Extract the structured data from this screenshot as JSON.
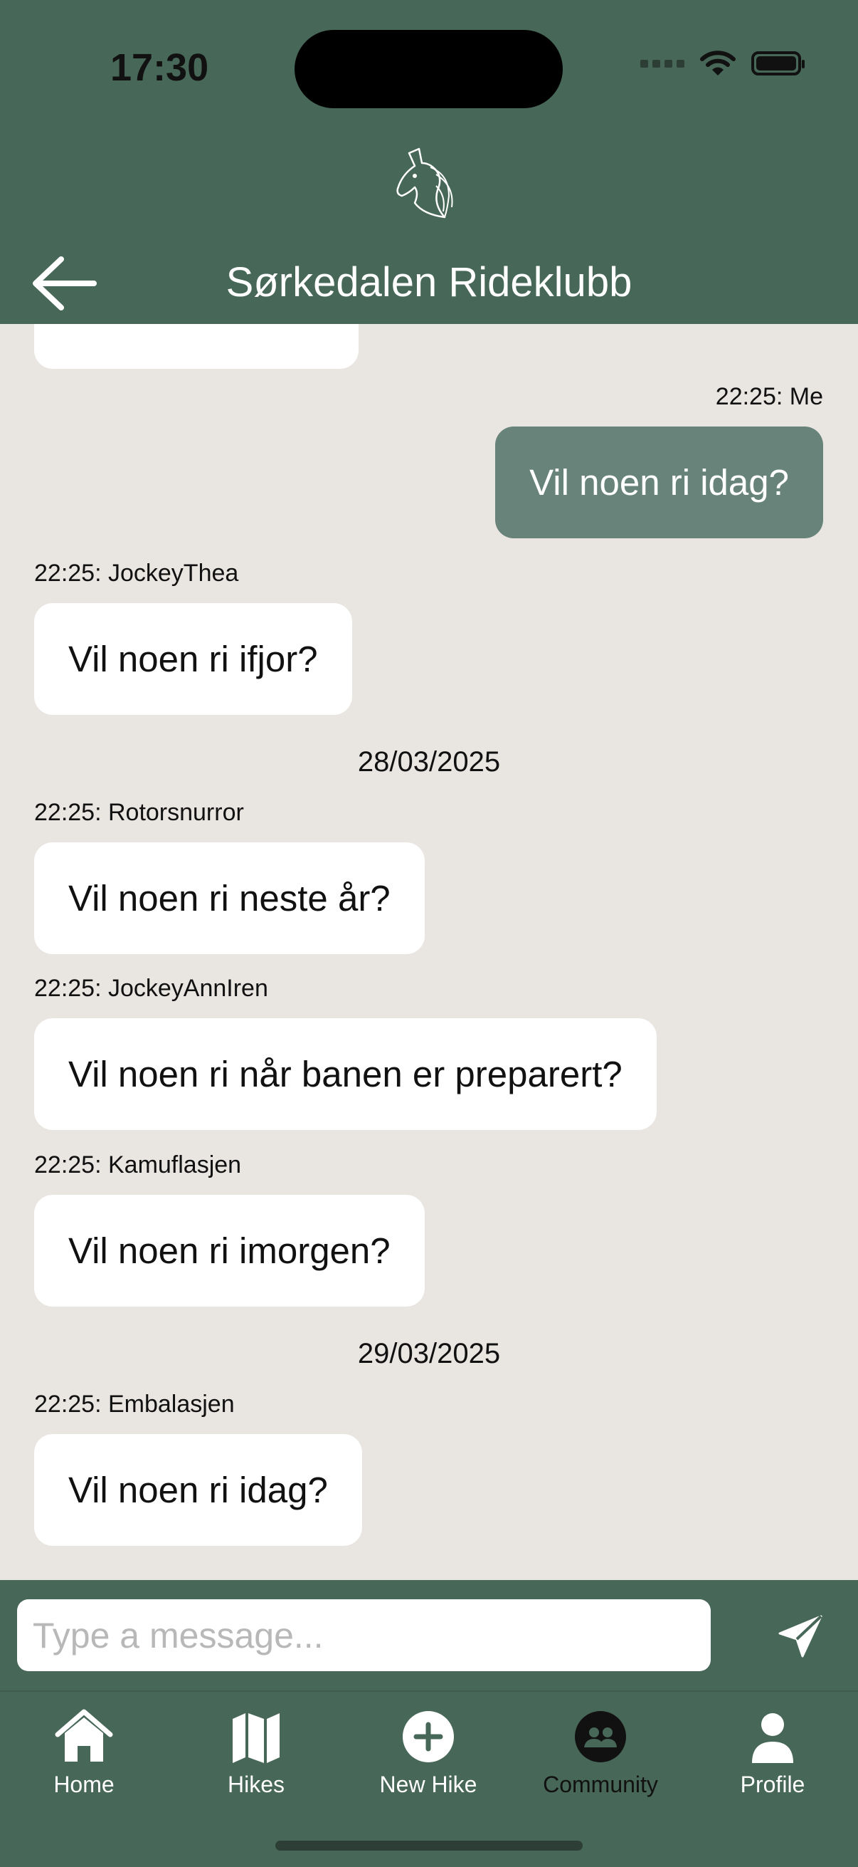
{
  "status_bar": {
    "time": "17:30"
  },
  "header": {
    "title": "Sørkedalen Rideklubb"
  },
  "messages": [
    {
      "meta": "22:25: Me",
      "text": "Vil noen ri idag?"
    },
    {
      "meta": "22:25: JockeyThea",
      "text": "Vil noen ri ifjor?"
    },
    {
      "meta": "22:25: Rotorsnurror",
      "text": "Vil noen ri neste år?"
    },
    {
      "meta": "22:25: JockeyAnnIren",
      "text": "Vil noen ri når banen er preparert?"
    },
    {
      "meta": "22:25: Kamuflasjen",
      "text": "Vil noen ri imorgen?"
    },
    {
      "meta": "22:25: Embalasjen",
      "text": "Vil noen ri idag?"
    }
  ],
  "dates": [
    "28/03/2025",
    "29/03/2025"
  ],
  "composer": {
    "placeholder": "Type a message..."
  },
  "tabs": [
    {
      "label": "Home",
      "icon": "home-icon"
    },
    {
      "label": "Hikes",
      "icon": "map-icon"
    },
    {
      "label": "New Hike",
      "icon": "plus-circle-icon"
    },
    {
      "label": "Community",
      "icon": "community-icon",
      "active": true
    },
    {
      "label": "Profile",
      "icon": "person-icon"
    }
  ],
  "colors": {
    "header": "#476758",
    "background": "#E9E5E1",
    "my_bubble": "#68837A",
    "active_tab": "#111111"
  }
}
